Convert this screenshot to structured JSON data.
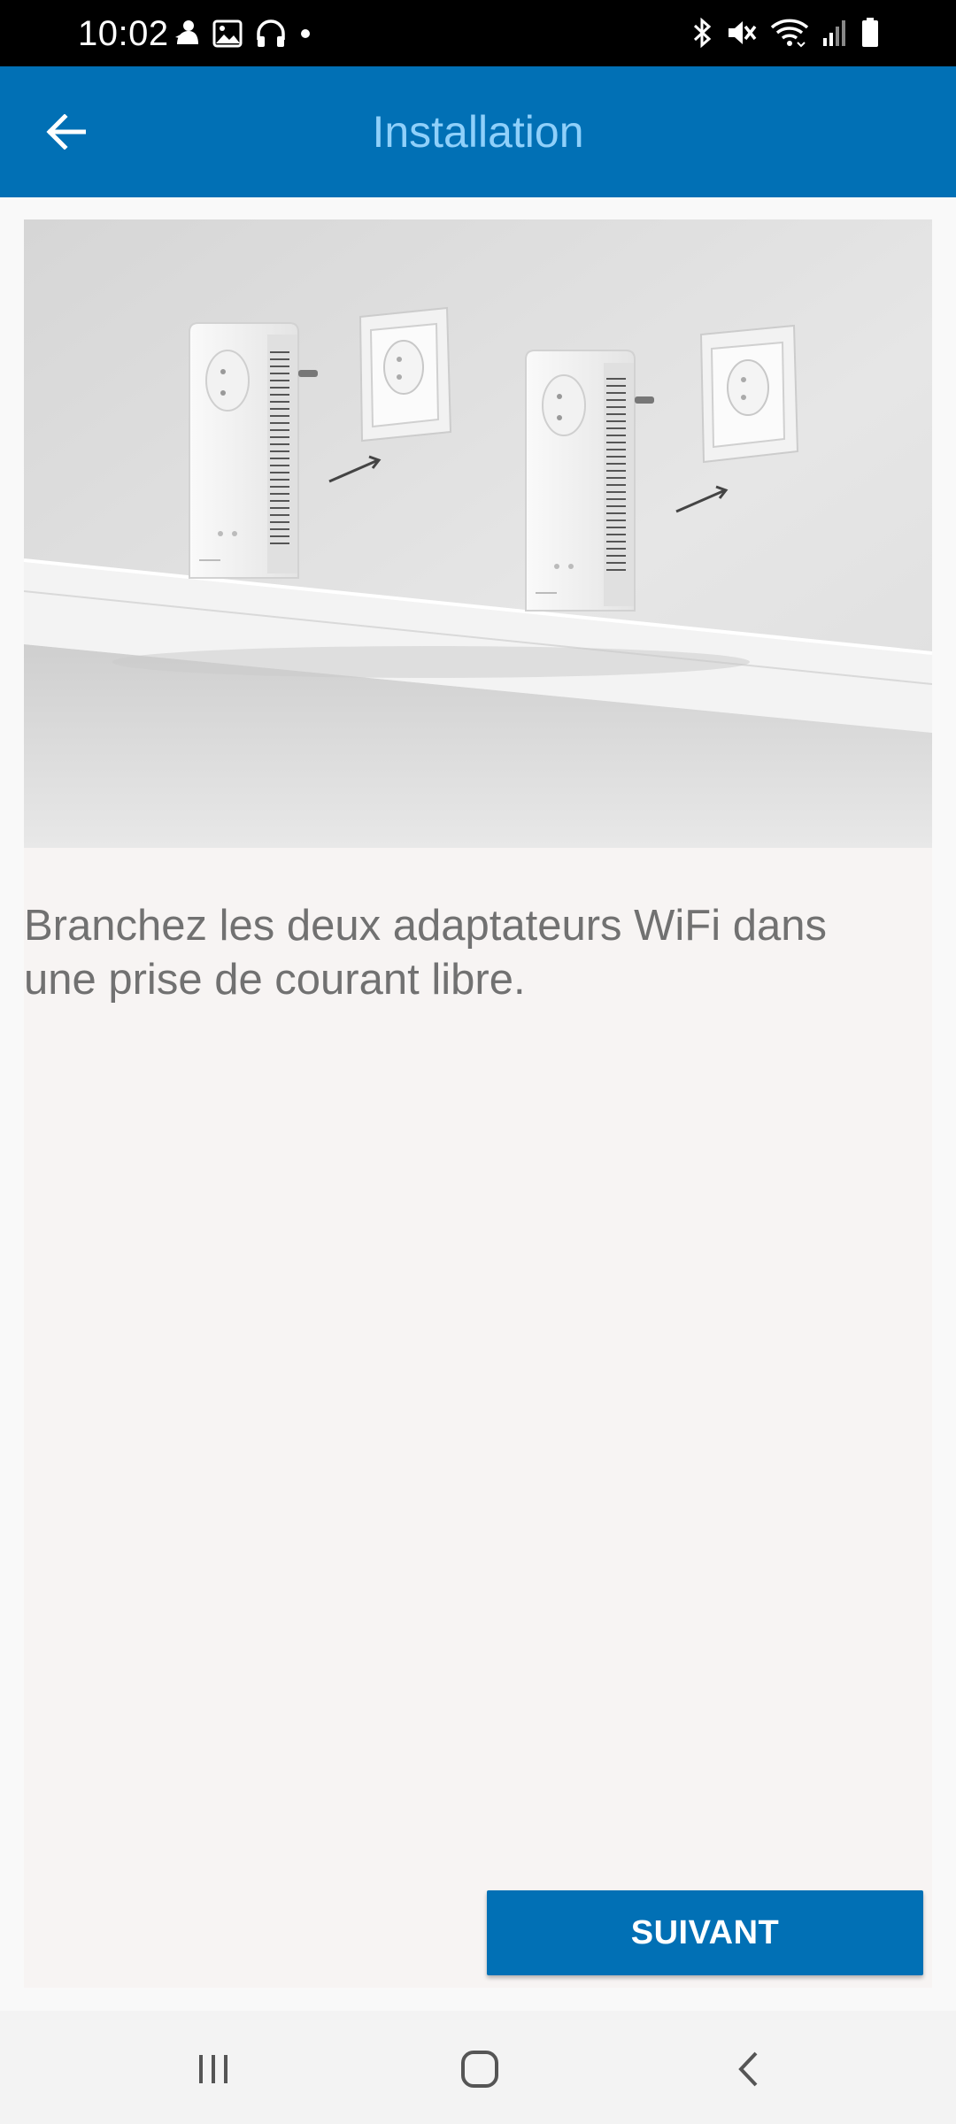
{
  "status_bar": {
    "time": "10:02",
    "left_icons": [
      "notification-app-icon",
      "gallery-icon",
      "headphones-icon",
      "dot-icon"
    ],
    "right_icons": [
      "bluetooth-icon",
      "mute-icon",
      "wifi-icon",
      "signal-icon",
      "battery-icon"
    ]
  },
  "app_bar": {
    "title": "Installation",
    "back_icon": "arrow-back-icon",
    "color": "#0170b5",
    "title_color": "#8fd0fa"
  },
  "content": {
    "hero_image": "two-powerline-adapters-plugged-into-wall-sockets",
    "instruction": "Branchez les deux adaptateurs WiFi dans une prise de courant libre."
  },
  "actions": {
    "next_label": "SUIVANT"
  },
  "nav_bar": {
    "icons": [
      "recents-icon",
      "home-icon",
      "back-icon"
    ]
  }
}
